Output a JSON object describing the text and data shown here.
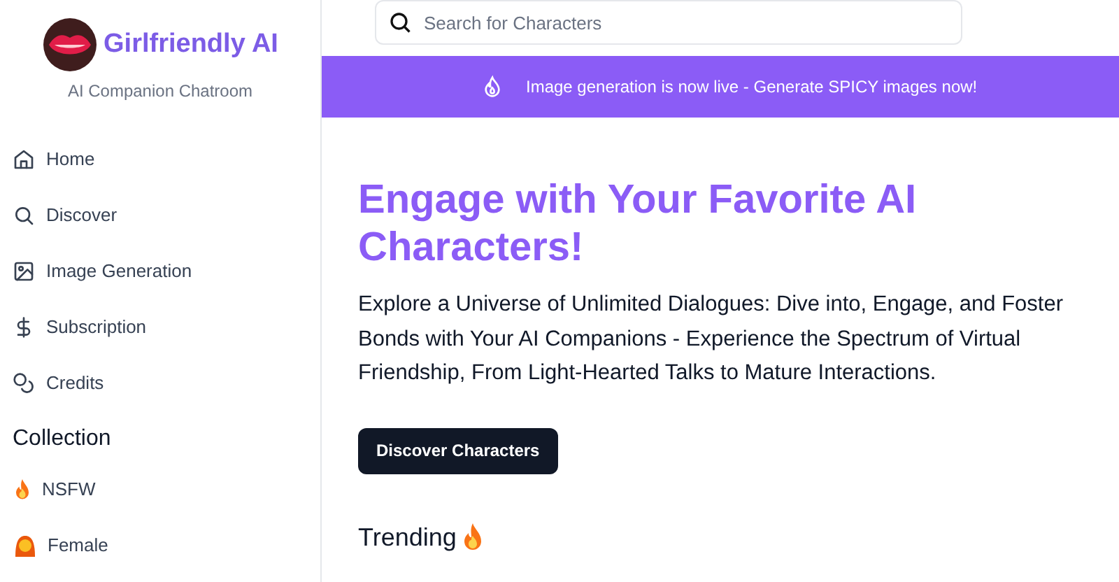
{
  "brand": {
    "name": "Girlfriendly AI",
    "tagline": "AI Companion Chatroom"
  },
  "nav": [
    {
      "label": "Home"
    },
    {
      "label": "Discover"
    },
    {
      "label": "Image Generation"
    },
    {
      "label": "Subscription"
    },
    {
      "label": "Credits"
    }
  ],
  "collection": {
    "title": "Collection",
    "items": [
      {
        "label": "NSFW"
      },
      {
        "label": "Female"
      }
    ]
  },
  "search": {
    "placeholder": "Search for Characters"
  },
  "banner": {
    "text": "Image generation is now live - Generate SPICY images now!"
  },
  "hero": {
    "title": "Engage with Your Favorite AI Characters!",
    "body": "Explore a Universe of Unlimited Dialogues: Dive into, Engage, and Foster Bonds with Your AI Companions - Experience the Spectrum of Virtual Friendship, From Light-Hearted Talks to Mature Interactions.",
    "button": "Discover Characters"
  },
  "trending": {
    "title": "Trending"
  }
}
